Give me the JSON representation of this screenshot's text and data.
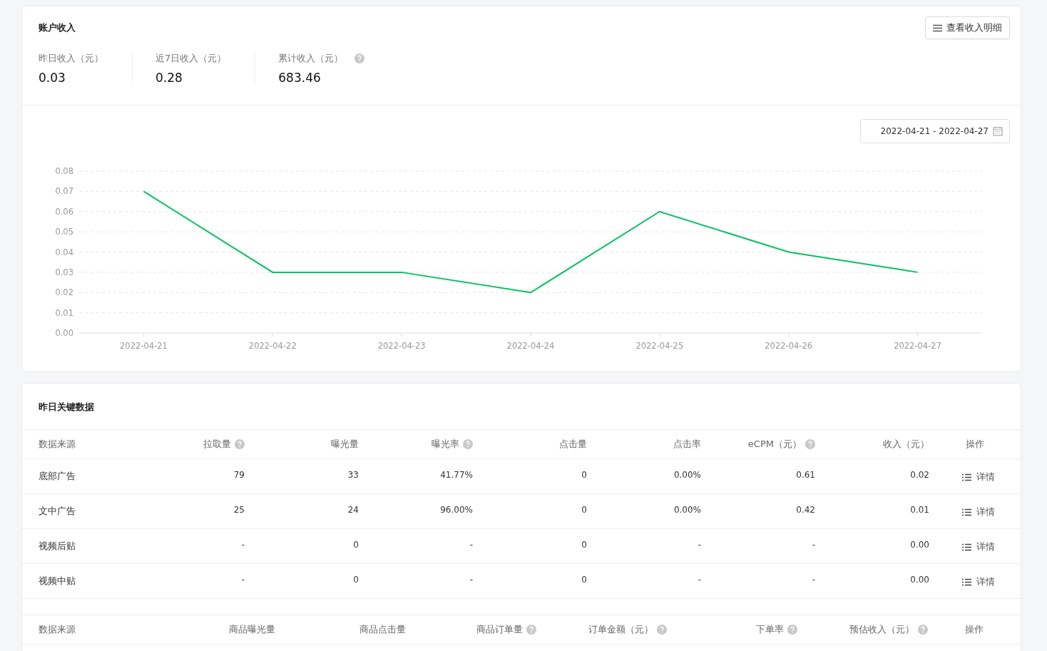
{
  "income": {
    "title": "账户收入",
    "detail_button": "查看收入明细",
    "stats": [
      {
        "label": "昨日收入（元）",
        "value": "0.03",
        "help": false
      },
      {
        "label": "近7日收入（元）",
        "value": "0.28",
        "help": false
      },
      {
        "label": "累计收入（元）",
        "value": "683.46",
        "help": true
      }
    ],
    "date_range": "2022-04-21 - 2022-04-27",
    "chart_data": {
      "type": "line",
      "categories": [
        "2022-04-21",
        "2022-04-22",
        "2022-04-23",
        "2022-04-24",
        "2022-04-25",
        "2022-04-26",
        "2022-04-27"
      ],
      "grid": true,
      "series": [
        {
          "color": "#07c160",
          "values": [
            0.07,
            0.03,
            0.03,
            0.02,
            0.06,
            0.04,
            0.03
          ]
        }
      ],
      "ylim": [
        0,
        0.08
      ],
      "yticks": [
        {
          "value": 0,
          "label": "0.00"
        },
        {
          "value": 0.01,
          "label": "0.01"
        },
        {
          "value": 0.02,
          "label": "0.02"
        },
        {
          "value": 0.03,
          "label": "0.03"
        },
        {
          "value": 0.04,
          "label": "0.04"
        },
        {
          "value": 0.05,
          "label": "0.05"
        },
        {
          "value": 0.06,
          "label": "0.06"
        },
        {
          "value": 0.07,
          "label": "0.07"
        },
        {
          "value": 0.08,
          "label": "0.08"
        }
      ]
    }
  },
  "key_data": {
    "title": "昨日关键数据",
    "ad_table": {
      "columns": [
        {
          "label": "数据来源",
          "help": false
        },
        {
          "label": "拉取量",
          "help": true
        },
        {
          "label": "曝光量",
          "help": false
        },
        {
          "label": "曝光率",
          "help": true
        },
        {
          "label": "点击量",
          "help": false
        },
        {
          "label": "点击率",
          "help": false
        },
        {
          "label": "eCPM（元）",
          "help": true
        },
        {
          "label": "收入（元）",
          "help": false
        },
        {
          "label": "操作",
          "help": false
        }
      ],
      "rows": [
        {
          "cells": [
            "底部广告",
            "79",
            "33",
            "41.77%",
            "0",
            "0.00%",
            "0.61",
            "0.02"
          ],
          "action": "详情"
        },
        {
          "cells": [
            "文中广告",
            "25",
            "24",
            "96.00%",
            "0",
            "0.00%",
            "0.42",
            "0.01"
          ],
          "action": "详情"
        },
        {
          "cells": [
            "视频后贴",
            "-",
            "0",
            "-",
            "0",
            "-",
            "-",
            "0.00"
          ],
          "action": "详情"
        },
        {
          "cells": [
            "视频中贴",
            "-",
            "0",
            "-",
            "0",
            "-",
            "-",
            "0.00"
          ],
          "action": "详情"
        }
      ]
    },
    "goods_table": {
      "columns": [
        {
          "label": "数据来源",
          "help": false
        },
        {
          "label": "商品曝光量",
          "help": false
        },
        {
          "label": "商品点击量",
          "help": false
        },
        {
          "label": "商品订单量",
          "help": true
        },
        {
          "label": "订单金额（元）",
          "help": true
        },
        {
          "label": "下单率",
          "help": true
        },
        {
          "label": "预估收入（元）",
          "help": true
        },
        {
          "label": "操作",
          "help": false
        }
      ]
    }
  }
}
